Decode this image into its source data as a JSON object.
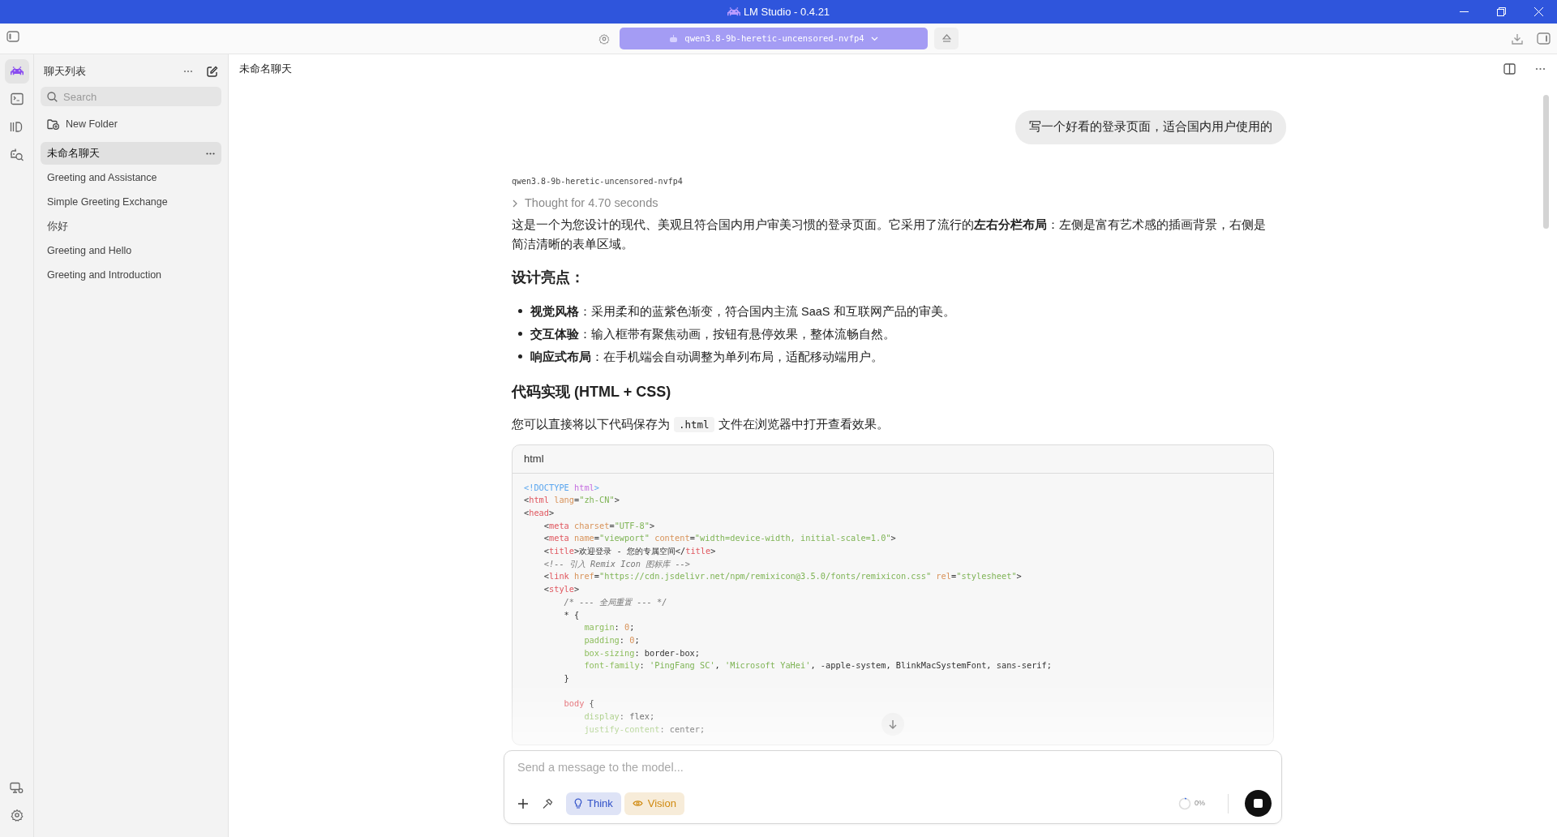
{
  "window": {
    "title": "LM Studio - 0.4.21"
  },
  "toolbar": {
    "model": "qwen3.8-9b-heretic-uncensored-nvfp4"
  },
  "rail": [
    {
      "kind": "chat",
      "selected": true
    },
    {
      "kind": "terminal",
      "selected": false
    },
    {
      "kind": "models",
      "selected": false
    },
    {
      "kind": "discover",
      "selected": false
    }
  ],
  "chat_list": {
    "title": "聊天列表",
    "search": {
      "placeholder": "Search"
    },
    "new_folder": "New Folder",
    "items": [
      {
        "label": "未命名聊天",
        "selected": true
      },
      {
        "label": "Greeting and Assistance",
        "selected": false
      },
      {
        "label": "Simple Greeting Exchange",
        "selected": false
      },
      {
        "label": "你好",
        "selected": false
      },
      {
        "label": "Greeting and Hello",
        "selected": false
      },
      {
        "label": "Greeting and Introduction",
        "selected": false
      }
    ]
  },
  "chat": {
    "title": "未命名聊天",
    "user_message": "写一个好看的登录页面，适合国内用户使用的",
    "model_label": "qwen3.8-9b-heretic-uncensored-nvfp4",
    "thought": {
      "label": "Thought for 4.70 seconds",
      "expanded": false
    },
    "blocks": [
      {
        "kind": "paragraph",
        "text": "这是一个为您设计的现代、美观且符合国内用户审美习惯的登录页面。它采用了流行的**左右分栏布局**：左侧是富有艺术感的插画背景，右侧是简洁清晰的表单区域。"
      },
      {
        "kind": "heading",
        "text": "设计亮点："
      },
      {
        "kind": "bullets",
        "items": [
          "**视觉风格**：采用柔和的蓝紫色渐变，符合国内主流 SaaS 和互联网产品的审美。",
          "**交互体验**：输入框带有聚焦动画，按钮有悬停效果，整体流畅自然。",
          "**响应式布局**：在手机端会自动调整为单列布局，适配移动端用户。"
        ]
      },
      {
        "kind": "heading",
        "text": "代码实现 (HTML + CSS)"
      },
      {
        "kind": "code_paragraph",
        "before": "您可以直接将以下代码保存为",
        "code": ".html",
        "after": "文件在浏览器中打开查看效果。"
      },
      {
        "kind": "code",
        "language": "html",
        "lines": [
          {
            "kind": "code",
            "tokens": [
              {
                "kind": "doctype",
                "text": "<!DOCTYPE "
              },
              {
                "kind": "keyword",
                "text": "html"
              },
              {
                "kind": "doctype",
                "text": ">"
              }
            ]
          },
          {
            "kind": "code",
            "tokens": [
              {
                "kind": "punct",
                "text": "<"
              },
              {
                "kind": "tag",
                "text": "html"
              },
              {
                "kind": "attr",
                "text": " lang"
              },
              {
                "kind": "punct",
                "text": "="
              },
              {
                "kind": "string",
                "text": "\"zh-CN\""
              },
              {
                "kind": "punct",
                "text": ">"
              }
            ]
          },
          {
            "kind": "code",
            "tokens": [
              {
                "kind": "punct",
                "text": "<"
              },
              {
                "kind": "tag",
                "text": "head"
              },
              {
                "kind": "punct",
                "text": ">"
              }
            ]
          },
          {
            "kind": "code",
            "tokens": [
              {
                "kind": "punct",
                "text": "    <"
              },
              {
                "kind": "tag",
                "text": "meta"
              },
              {
                "kind": "attr",
                "text": " charset"
              },
              {
                "kind": "punct",
                "text": "="
              },
              {
                "kind": "string",
                "text": "\"UTF-8\""
              },
              {
                "kind": "punct",
                "text": ">"
              }
            ]
          },
          {
            "kind": "code",
            "tokens": [
              {
                "kind": "punct",
                "text": "    <"
              },
              {
                "kind": "tag",
                "text": "meta"
              },
              {
                "kind": "attr",
                "text": " name"
              },
              {
                "kind": "punct",
                "text": "="
              },
              {
                "kind": "string",
                "text": "\"viewport\""
              },
              {
                "kind": "attr",
                "text": " content"
              },
              {
                "kind": "punct",
                "text": "="
              },
              {
                "kind": "string",
                "text": "\"width=device-width, initial-scale=1.0\""
              },
              {
                "kind": "punct",
                "text": ">"
              }
            ]
          },
          {
            "kind": "code",
            "tokens": [
              {
                "kind": "punct",
                "text": "    <"
              },
              {
                "kind": "tag",
                "text": "title"
              },
              {
                "kind": "punct",
                "text": ">欢迎登录 - 您的专属空间</"
              },
              {
                "kind": "tag",
                "text": "title"
              },
              {
                "kind": "punct",
                "text": ">"
              }
            ]
          },
          {
            "kind": "code",
            "tokens": [
              {
                "kind": "comment",
                "text": "    <!-- 引入 Remix Icon 图标库 -->"
              }
            ]
          },
          {
            "kind": "code",
            "tokens": [
              {
                "kind": "punct",
                "text": "    <"
              },
              {
                "kind": "tag",
                "text": "link"
              },
              {
                "kind": "attr",
                "text": " href"
              },
              {
                "kind": "punct",
                "text": "="
              },
              {
                "kind": "string",
                "text": "\"https://cdn.jsdelivr.net/npm/remixicon@3.5.0/fonts/remixicon.css\""
              },
              {
                "kind": "attr",
                "text": " rel"
              },
              {
                "kind": "punct",
                "text": "="
              },
              {
                "kind": "string",
                "text": "\"stylesheet\""
              },
              {
                "kind": "punct",
                "text": ">"
              }
            ]
          },
          {
            "kind": "code",
            "tokens": [
              {
                "kind": "punct",
                "text": "    <"
              },
              {
                "kind": "tag",
                "text": "style"
              },
              {
                "kind": "punct",
                "text": ">"
              }
            ]
          },
          {
            "kind": "code",
            "tokens": [
              {
                "kind": "comment",
                "text": "        /* --- 全局重置 --- */"
              }
            ]
          },
          {
            "kind": "code",
            "tokens": [
              {
                "kind": "punct",
                "text": "        * {"
              }
            ]
          },
          {
            "kind": "code",
            "tokens": [
              {
                "kind": "property",
                "text": "            margin"
              },
              {
                "kind": "punct",
                "text": ": "
              },
              {
                "kind": "number",
                "text": "0"
              },
              {
                "kind": "punct",
                "text": ";"
              }
            ]
          },
          {
            "kind": "code",
            "tokens": [
              {
                "kind": "property",
                "text": "            padding"
              },
              {
                "kind": "punct",
                "text": ": "
              },
              {
                "kind": "number",
                "text": "0"
              },
              {
                "kind": "punct",
                "text": ";"
              }
            ]
          },
          {
            "kind": "code",
            "tokens": [
              {
                "kind": "property",
                "text": "            box-sizing"
              },
              {
                "kind": "punct",
                "text": ": border-box;"
              }
            ]
          },
          {
            "kind": "code",
            "tokens": [
              {
                "kind": "property",
                "text": "            font-family"
              },
              {
                "kind": "punct",
                "text": ": "
              },
              {
                "kind": "string",
                "text": "'PingFang SC'"
              },
              {
                "kind": "punct",
                "text": ", "
              },
              {
                "kind": "string",
                "text": "'Microsoft YaHei'"
              },
              {
                "kind": "punct",
                "text": ", -apple-system, BlinkMacSystemFont, sans-serif;"
              }
            ]
          },
          {
            "kind": "code",
            "tokens": [
              {
                "kind": "punct",
                "text": "        }"
              }
            ]
          },
          {
            "kind": "blank"
          },
          {
            "kind": "code",
            "tokens": [
              {
                "kind": "tag",
                "text": "        body"
              },
              {
                "kind": "punct",
                "text": " {"
              }
            ]
          },
          {
            "kind": "code",
            "tokens": [
              {
                "kind": "property",
                "text": "            display"
              },
              {
                "kind": "punct",
                "text": ": flex;"
              }
            ]
          },
          {
            "kind": "code",
            "tokens": [
              {
                "kind": "property",
                "text": "            justify-content"
              },
              {
                "kind": "punct",
                "text": ": center;"
              }
            ]
          }
        ]
      }
    ]
  },
  "composer": {
    "placeholder": "Send a message to the model...",
    "toggles": [
      {
        "label": "Think",
        "on": true,
        "color": "#3050c8"
      },
      {
        "label": "Vision",
        "on": true,
        "color": "#d08a10"
      }
    ],
    "progress": "0%"
  }
}
